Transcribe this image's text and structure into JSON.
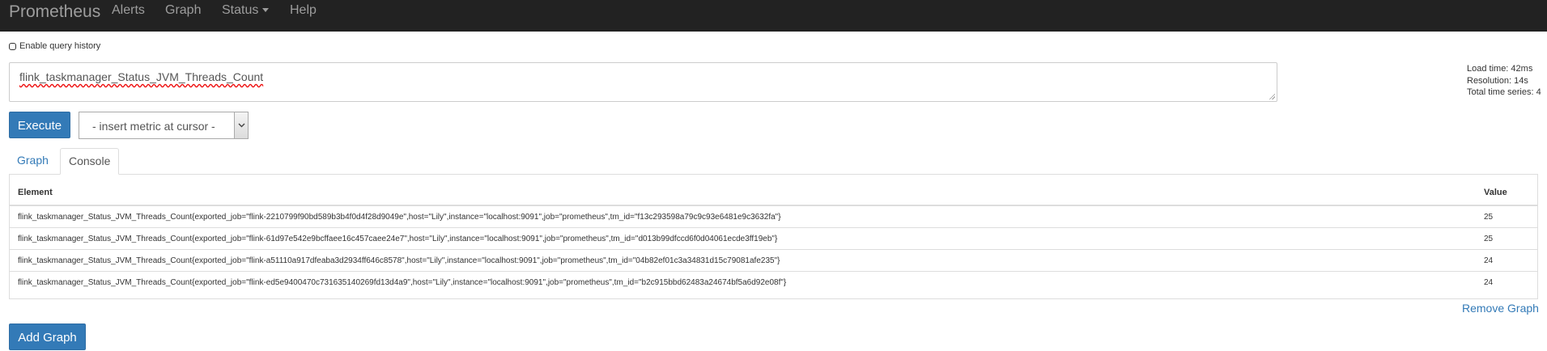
{
  "navbar": {
    "brand": "Prometheus",
    "items": [
      {
        "label": "Alerts"
      },
      {
        "label": "Graph"
      },
      {
        "label": "Status"
      },
      {
        "label": "Help"
      }
    ]
  },
  "query_history": {
    "label": "Enable query history",
    "checked": false
  },
  "expression": {
    "value": "flink_taskmanager_Status_JVM_Threads_Count"
  },
  "stats": {
    "load_time": "Load time: 42ms",
    "resolution": "Resolution: 14s",
    "total_series": "Total time series: 4"
  },
  "execute_button": "Execute",
  "metric_select": {
    "selected": "- insert metric at cursor -"
  },
  "tabs": [
    {
      "label": "Graph",
      "active": false
    },
    {
      "label": "Console",
      "active": true
    }
  ],
  "table": {
    "headers": {
      "element": "Element",
      "value": "Value"
    },
    "rows": [
      {
        "element": "flink_taskmanager_Status_JVM_Threads_Count{exported_job=\"flink-2210799f90bd589b3b4f0d4f28d9049e\",host=\"Lily\",instance=\"localhost:9091\",job=\"prometheus\",tm_id=\"f13c293598a79c9c93e6481e9c3632fa\"}",
        "value": "25"
      },
      {
        "element": "flink_taskmanager_Status_JVM_Threads_Count{exported_job=\"flink-61d97e542e9bcffaee16c457caee24e7\",host=\"Lily\",instance=\"localhost:9091\",job=\"prometheus\",tm_id=\"d013b99dfccd6f0d04061ecde3ff19eb\"}",
        "value": "25"
      },
      {
        "element": "flink_taskmanager_Status_JVM_Threads_Count{exported_job=\"flink-a51110a917dfeaba3d2934ff646c8578\",host=\"Lily\",instance=\"localhost:9091\",job=\"prometheus\",tm_id=\"04b82ef01c3a34831d15c79081afe235\"}",
        "value": "24"
      },
      {
        "element": "flink_taskmanager_Status_JVM_Threads_Count{exported_job=\"flink-ed5e9400470c731635140269fd13d4a9\",host=\"Lily\",instance=\"localhost:9091\",job=\"prometheus\",tm_id=\"b2c915bbd62483a24674bf5a6d92e08f\"}",
        "value": "24"
      }
    ]
  },
  "remove_graph": "Remove Graph",
  "add_graph": "Add Graph",
  "colors": {
    "navbar": "#222222",
    "primary": "#337ab7",
    "nav_text": "#9d9d9d"
  },
  "icons": {
    "select_arrow": "chevron-down-icon",
    "textarea_resize": "resize-handle-icon"
  }
}
